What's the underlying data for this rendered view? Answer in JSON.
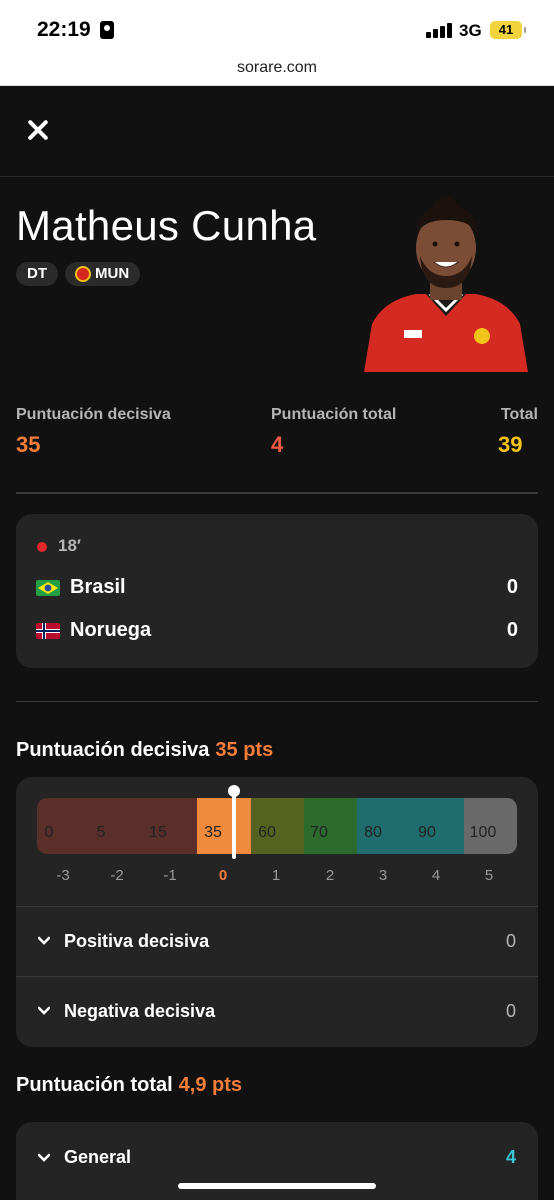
{
  "status_bar": {
    "time": "22:19",
    "network": "3G",
    "battery": "41"
  },
  "url_bar": {
    "url": "sorare.com"
  },
  "player": {
    "name": "Matheus Cunha",
    "position": "DT",
    "club": "MUN"
  },
  "stats": [
    {
      "label": "Puntuación decisiva",
      "value": "35",
      "color": "#f47d3a"
    },
    {
      "label": "Puntuación total",
      "value": "4",
      "color": "#f05a43"
    },
    {
      "label": "Total",
      "value": "39",
      "color": "#f3c318"
    }
  ],
  "match": {
    "minute": "18′",
    "teams": [
      {
        "name": "Brasil",
        "score": "0",
        "flag": "brazil-flag-icon"
      },
      {
        "name": "Noruega",
        "score": "0",
        "flag": "norway-flag-icon"
      }
    ]
  },
  "decisive": {
    "title": "Puntuación decisiva",
    "points": "35 pts",
    "scale_values": [
      "0",
      "5",
      "15",
      "35",
      "60",
      "70",
      "80",
      "90",
      "100"
    ],
    "scale_ticks": [
      "-3",
      "-2",
      "-1",
      "0",
      "1",
      "2",
      "3",
      "4",
      "5"
    ],
    "current_level": "0",
    "rows": [
      {
        "label": "Positiva decisiva",
        "value": "0"
      },
      {
        "label": "Negativa decisiva",
        "value": "0"
      }
    ]
  },
  "total": {
    "title": "Puntuación total",
    "points": "4,9 pts",
    "rows": [
      {
        "label": "General",
        "value": "4",
        "color": "#39c6d4"
      }
    ]
  },
  "colors": {
    "accent": "#f47d3a",
    "background": "#111111",
    "card": "#242424"
  }
}
